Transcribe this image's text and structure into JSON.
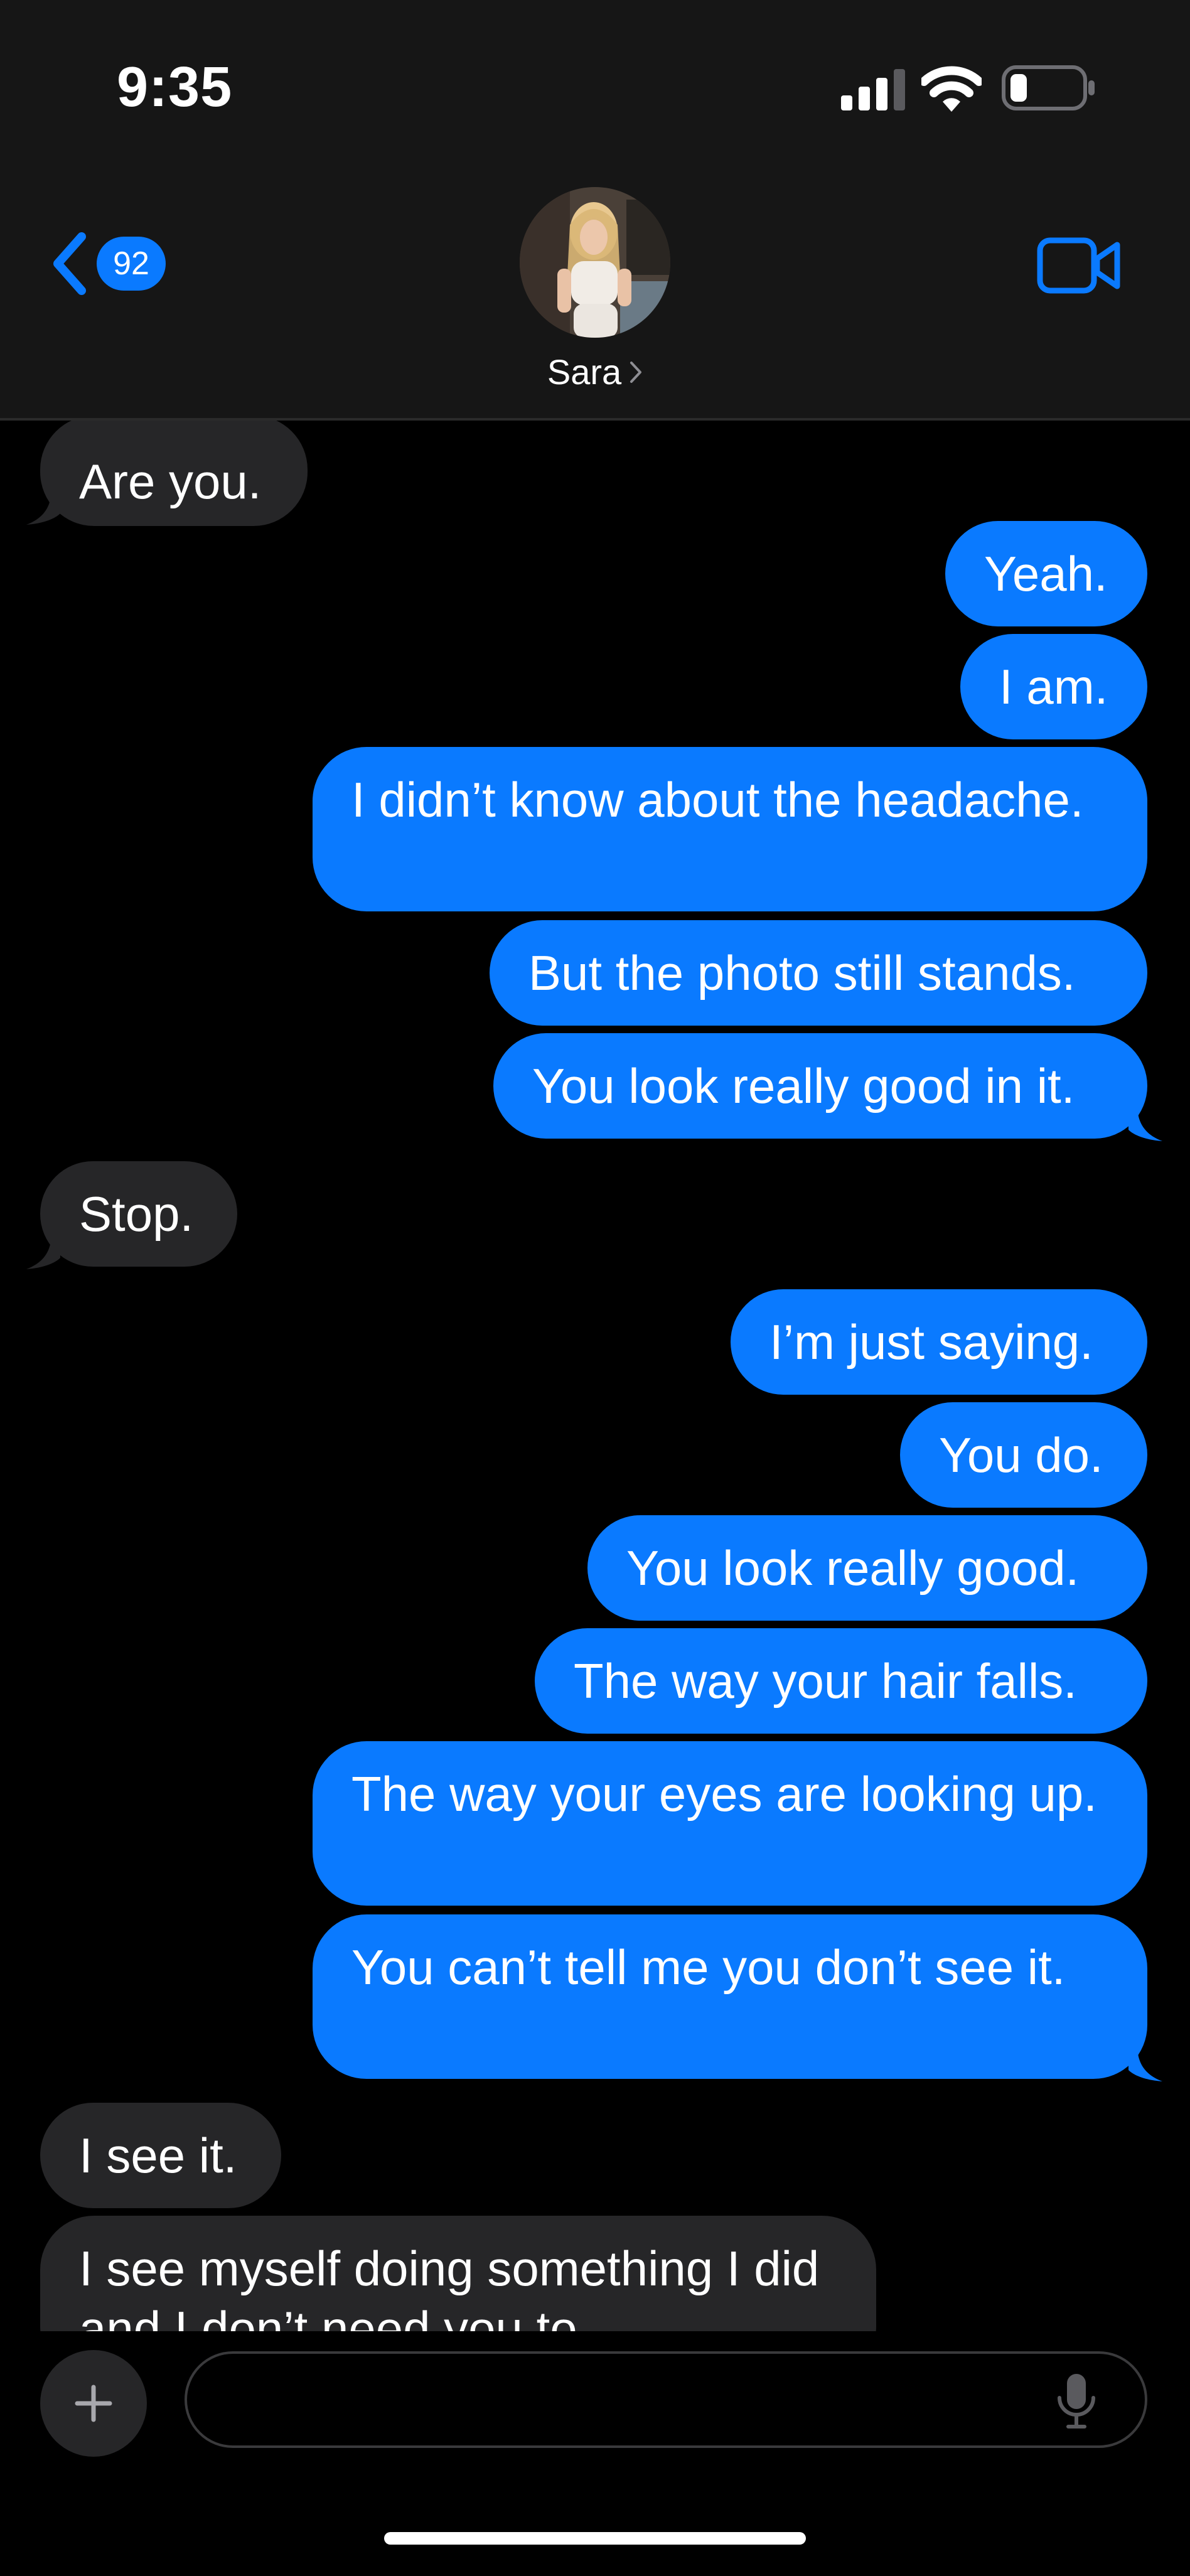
{
  "status_bar": {
    "time": "9:35",
    "icons": [
      "cellular-signal-icon",
      "wifi-icon",
      "battery-icon"
    ]
  },
  "header": {
    "back_badge": "92",
    "contact_name": "Sara",
    "icons": [
      "chevron-left-icon",
      "chevron-right-icon",
      "video-camera-icon"
    ]
  },
  "colors": {
    "sent_bubble": "#0a7aff",
    "received_bubble": "#262628",
    "header_bg": "#161616",
    "background": "#000000",
    "accent": "#0a7aff"
  },
  "messages": [
    {
      "direction": "received",
      "text": "Are you."
    },
    {
      "direction": "sent",
      "text": "Yeah."
    },
    {
      "direction": "sent",
      "text": "I am."
    },
    {
      "direction": "sent",
      "text": "I didn’t know about the headache."
    },
    {
      "direction": "sent",
      "text": "But the photo still stands."
    },
    {
      "direction": "sent",
      "text": "You look really good in it."
    },
    {
      "direction": "received",
      "text": "Stop."
    },
    {
      "direction": "sent",
      "text": "I’m just saying."
    },
    {
      "direction": "sent",
      "text": "You do."
    },
    {
      "direction": "sent",
      "text": "You look really good."
    },
    {
      "direction": "sent",
      "text": "The way your hair falls."
    },
    {
      "direction": "sent",
      "text": "The way your eyes are looking up."
    },
    {
      "direction": "sent",
      "text": "You can’t tell me you don’t see it."
    },
    {
      "direction": "received",
      "text": "I see it."
    },
    {
      "direction": "received",
      "text": "I see myself doing something I did and I don’t need you to"
    }
  ],
  "compose": {
    "placeholder": "",
    "value": "",
    "icons": [
      "plus-icon",
      "microphone-icon"
    ]
  }
}
